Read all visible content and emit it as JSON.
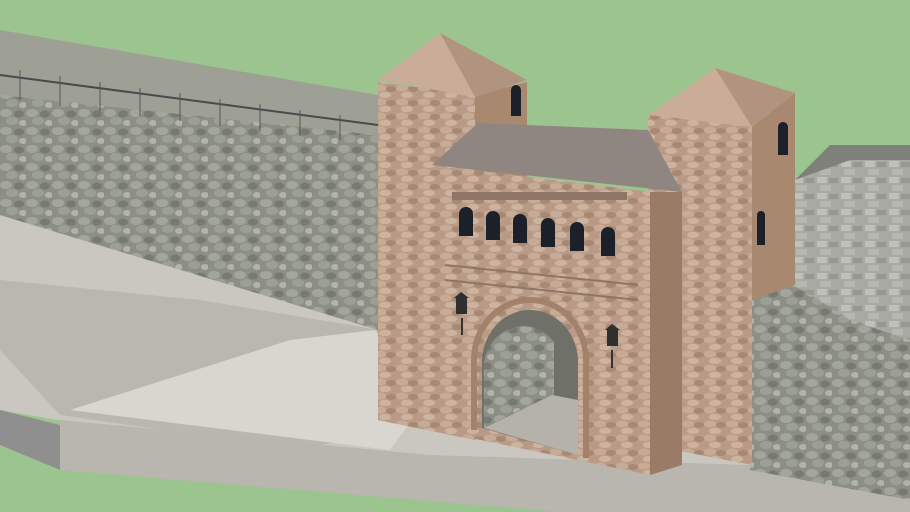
{
  "scene": {
    "subject": "stone-gate-3d-model",
    "colors": {
      "background": "#9cc48f",
      "stone": "#b99a86",
      "stone_dark": "#8e7566",
      "roof": "#c9ad98",
      "rubble_wall": "#8d8f85",
      "ground": "#c9c7c0",
      "window": "#1c2028"
    }
  }
}
